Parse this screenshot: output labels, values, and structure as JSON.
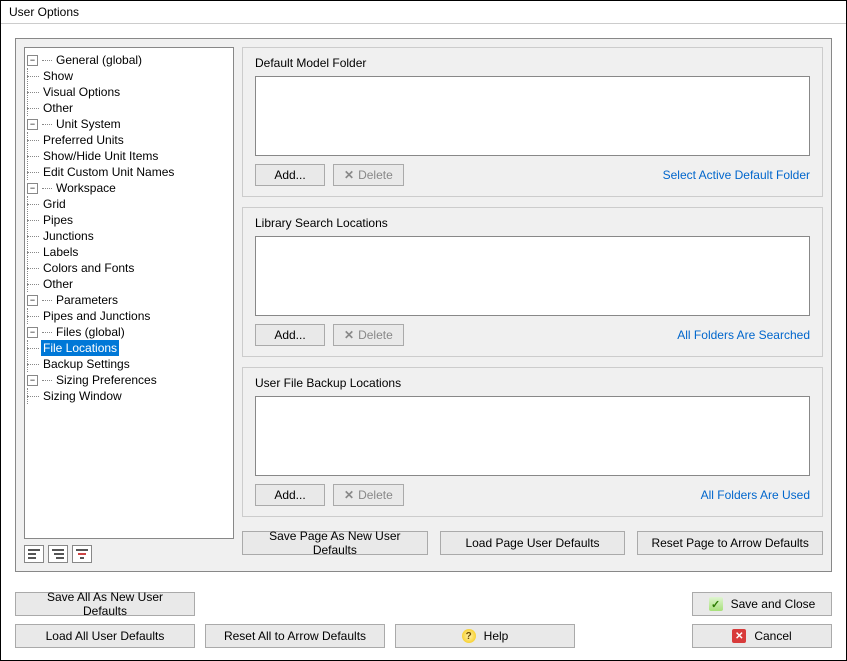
{
  "window": {
    "title": "User Options"
  },
  "tree": {
    "items": [
      {
        "label": "General (global)",
        "children": [
          "Show",
          "Visual Options",
          "Other"
        ]
      },
      {
        "label": "Unit System",
        "children": [
          "Preferred Units",
          "Show/Hide Unit Items",
          "Edit Custom Unit Names"
        ]
      },
      {
        "label": "Workspace",
        "children": [
          "Grid",
          "Pipes",
          "Junctions",
          "Labels",
          "Colors and Fonts",
          "Other"
        ]
      },
      {
        "label": "Parameters",
        "children": [
          "Pipes and Junctions"
        ]
      },
      {
        "label": "Files (global)",
        "children": [
          "File Locations",
          "Backup Settings"
        ],
        "selectedChild": 0
      },
      {
        "label": "Sizing Preferences",
        "children": [
          "Sizing Window"
        ]
      }
    ]
  },
  "panel": {
    "groups": [
      {
        "title": "Default Model Folder",
        "add": "Add...",
        "delete": "Delete",
        "link": "Select Active Default Folder"
      },
      {
        "title": "Library Search Locations",
        "add": "Add...",
        "delete": "Delete",
        "link": "All Folders Are Searched"
      },
      {
        "title": "User File Backup Locations",
        "add": "Add...",
        "delete": "Delete",
        "link": "All Folders Are Used"
      }
    ],
    "pageButtons": {
      "saveDefaults": "Save Page As New User Defaults",
      "loadDefaults": "Load Page User Defaults",
      "resetArrow": "Reset Page to Arrow Defaults"
    }
  },
  "bottom": {
    "saveAll": "Save All As New User Defaults",
    "loadAll": "Load All User Defaults",
    "resetAll": "Reset All to Arrow Defaults",
    "saveClose": "Save and Close",
    "help": "Help",
    "cancel": "Cancel"
  }
}
